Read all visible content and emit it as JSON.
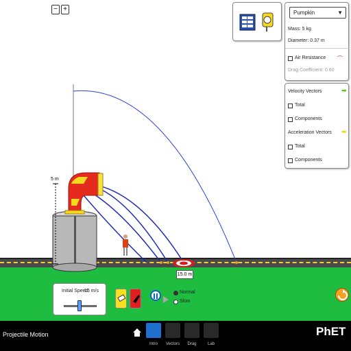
{
  "zoom": {
    "zoom_out_icon": "magnifier-minus-icon",
    "zoom_in_icon": "magnifier-plus-icon"
  },
  "toolbox": {
    "tape_measure_icon": "tape-measure-icon",
    "stopwatch_datatable_icon": "data-table-icon"
  },
  "projectile_panel": {
    "selected_projectile": "Pumpkin",
    "mass_label": "Mass: 5 kg",
    "diameter_label": "Diameter: 0.37 m",
    "air_resistance_label": "Air Resistance",
    "air_resistance_checked": false,
    "drag_coefficient_label": "Drag Coefficient: 0.60"
  },
  "vectors_panel": {
    "velocity_title": "Velocity Vectors",
    "velocity_total": "Total",
    "velocity_components": "Components",
    "acceleration_title": "Acceleration Vectors",
    "acceleration_total": "Total",
    "acceleration_components": "Components",
    "velocity_arrow_color": "#4cc21a",
    "acceleration_arrow_color": "#e6d800"
  },
  "cannon": {
    "height_label": "5 m"
  },
  "target": {
    "distance_label": "15.0 m"
  },
  "launch_controls": {
    "initial_speed_label": "Initial Speed:",
    "initial_speed_value": "15 m/s"
  },
  "playback": {
    "speed_normal": "Normal",
    "speed_slow": "Slow",
    "selected_speed": "Normal"
  },
  "navbar": {
    "sim_title": "Projectile Motion",
    "screens": [
      {
        "label": "Intro",
        "color": "#1e6fd0"
      },
      {
        "label": "Vectors",
        "color": "#2a2a2a"
      },
      {
        "label": "Drag",
        "color": "#2a2a2a"
      },
      {
        "label": "Lab",
        "color": "#2a2a2a"
      }
    ],
    "brand": "PhET"
  },
  "colors": {
    "trajectory": "#2a3fd8",
    "grass": "#1ebd3f",
    "cannon_red": "#e52a1e"
  }
}
